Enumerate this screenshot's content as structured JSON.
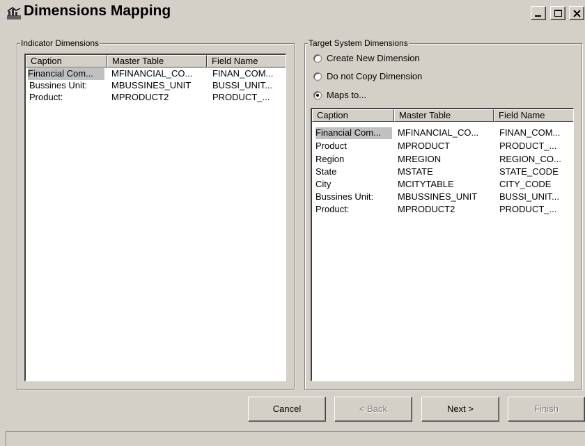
{
  "window": {
    "title": "Dimensions Mapping",
    "controls": [
      "minimize-icon",
      "maximize-icon",
      "close-icon"
    ]
  },
  "indicator": {
    "legend": "Indicator Dimensions",
    "columns": [
      "Caption",
      "Master Table",
      "Field Name"
    ],
    "rows": [
      [
        "Financial Com...",
        "MFINANCIAL_CO...",
        "FINAN_COM..."
      ],
      [
        "Bussines Unit:",
        "MBUSSINES_UNIT",
        "BUSSI_UNIT..."
      ],
      [
        "Product:",
        "MPRODUCT2",
        "PRODUCT_..."
      ]
    ]
  },
  "target": {
    "legend": "Target System Dimensions",
    "options": [
      "Create New Dimension",
      "Do not Copy Dimension",
      "Maps to..."
    ],
    "selected_option": "Maps to...",
    "columns": [
      "Caption",
      "Master Table",
      "Field Name"
    ],
    "rows": [
      [
        "Financial Com...",
        "MFINANCIAL_CO...",
        "FINAN_COM..."
      ],
      [
        "Product",
        "MPRODUCT",
        "PRODUCT_..."
      ],
      [
        "Region",
        "MREGION",
        "REGION_CO..."
      ],
      [
        "State",
        "MSTATE",
        "STATE_CODE"
      ],
      [
        "City",
        "MCITYTABLE",
        "CITY_CODE"
      ],
      [
        "Bussines Unit:",
        "MBUSSINES_UNIT",
        "BUSSI_UNIT..."
      ],
      [
        "Product:",
        "MPRODUCT2",
        "PRODUCT_..."
      ]
    ]
  },
  "buttons": {
    "cancel": "Cancel",
    "back": "< Back",
    "next": "Next >",
    "finish": "Finish"
  }
}
